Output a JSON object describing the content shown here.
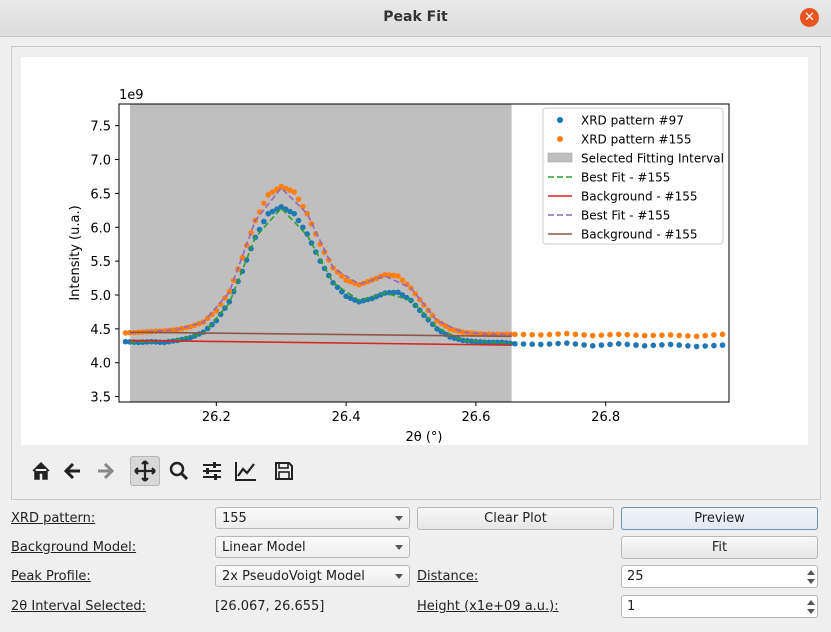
{
  "window": {
    "title": "Peak Fit",
    "close_glyph": "✕"
  },
  "toolbar": {
    "icons": [
      "home-icon",
      "back-arrow-icon",
      "forward-arrow-icon",
      "pan-icon",
      "zoom-icon",
      "configure-subplots-icon",
      "edit-axis-icon",
      "save-icon"
    ],
    "active": "pan-icon"
  },
  "controls": {
    "xrd_pattern_label": "XRD pattern:",
    "xrd_pattern_value": "155",
    "background_model_label": "Background Model:",
    "background_model_value": "Linear Model",
    "peak_profile_label": "Peak Profile:",
    "peak_profile_value": "2x PseudoVoigt Model",
    "interval_label": "2θ Interval Selected:",
    "interval_value": "[26.067, 26.655]",
    "clear_plot": "Clear Plot",
    "preview": "Preview",
    "fit": "Fit",
    "distance_label": "Distance:",
    "distance_value": "25",
    "height_label": "Height (x1e+09 a.u.):",
    "height_value": "1"
  },
  "chart_data": {
    "type": "scatter",
    "xlabel": "2θ (°)",
    "ylabel": "Intensity (u.a.)",
    "y_offset_label": "1e9",
    "xlim": [
      26.05,
      26.99
    ],
    "ylim": [
      3.42,
      7.82
    ],
    "xticks": [
      "26.2",
      "26.4",
      "26.6",
      "26.8"
    ],
    "xtick_values": [
      26.2,
      26.4,
      26.6,
      26.8
    ],
    "yticks": [
      "3.5",
      "4.0",
      "4.5",
      "5.0",
      "5.5",
      "6.0",
      "6.5",
      "7.0",
      "7.5"
    ],
    "ytick_values": [
      3.5,
      4.0,
      4.5,
      5.0,
      5.5,
      6.0,
      6.5,
      7.0,
      7.5
    ],
    "fit_interval": [
      26.067,
      26.655
    ],
    "legend_position": "top-right",
    "legend": [
      "XRD pattern #97",
      "XRD pattern #155",
      "Selected Fitting Interval",
      "Best Fit - #155",
      "Background - #155",
      "Best Fit - #155",
      "Background - #155"
    ],
    "colors": {
      "pattern_97": "#1f77b4",
      "pattern_155": "#ff7f0e",
      "interval": "#bfbfbf",
      "best_fit_1": "#2ca02c",
      "background_1": "#d62728",
      "best_fit_2": "#9467bd",
      "background_2": "#8c564b"
    },
    "series": [
      {
        "name": "XRD pattern #97",
        "x": [
          26.06,
          26.08,
          26.1,
          26.12,
          26.14,
          26.16,
          26.18,
          26.2,
          26.22,
          26.24,
          26.26,
          26.28,
          26.3,
          26.32,
          26.34,
          26.36,
          26.38,
          26.4,
          26.42,
          26.44,
          26.46,
          26.48,
          26.5,
          26.52,
          26.54,
          26.56,
          26.58,
          26.6,
          26.62,
          26.64,
          26.66,
          26.7,
          26.74,
          26.78,
          26.82,
          26.86,
          26.9,
          26.94,
          26.98
        ],
        "y": [
          4.31,
          4.3,
          4.31,
          4.3,
          4.33,
          4.37,
          4.45,
          4.62,
          4.9,
          5.35,
          5.85,
          6.2,
          6.3,
          6.2,
          5.9,
          5.5,
          5.18,
          4.98,
          4.9,
          4.95,
          5.03,
          5.04,
          4.92,
          4.7,
          4.5,
          4.38,
          4.33,
          4.31,
          4.3,
          4.3,
          4.28,
          4.27,
          4.29,
          4.25,
          4.28,
          4.25,
          4.27,
          4.24,
          4.26
        ]
      },
      {
        "name": "XRD pattern #155",
        "x": [
          26.06,
          26.08,
          26.1,
          26.12,
          26.14,
          26.16,
          26.18,
          26.2,
          26.22,
          26.24,
          26.26,
          26.28,
          26.3,
          26.32,
          26.34,
          26.36,
          26.38,
          26.4,
          26.42,
          26.44,
          26.46,
          26.48,
          26.5,
          26.52,
          26.54,
          26.56,
          26.58,
          26.6,
          26.62,
          26.64,
          26.66,
          26.7,
          26.74,
          26.78,
          26.82,
          26.86,
          26.9,
          26.94,
          26.98
        ],
        "y": [
          4.44,
          4.45,
          4.46,
          4.47,
          4.49,
          4.53,
          4.6,
          4.77,
          5.05,
          5.55,
          6.1,
          6.48,
          6.6,
          6.52,
          6.2,
          5.75,
          5.4,
          5.22,
          5.15,
          5.22,
          5.3,
          5.28,
          5.1,
          4.85,
          4.62,
          4.5,
          4.45,
          4.43,
          4.42,
          4.42,
          4.42,
          4.41,
          4.43,
          4.4,
          4.42,
          4.4,
          4.41,
          4.39,
          4.42
        ]
      },
      {
        "name": "Best Fit - #155",
        "x": [
          26.067,
          26.1,
          26.14,
          26.18,
          26.22,
          26.26,
          26.3,
          26.34,
          26.38,
          26.42,
          26.46,
          26.5,
          26.54,
          26.58,
          26.62,
          26.655
        ],
        "y": [
          4.3,
          4.31,
          4.34,
          4.43,
          4.88,
          5.85,
          6.28,
          5.88,
          5.18,
          4.92,
          5.03,
          4.92,
          4.52,
          4.33,
          4.3,
          4.29
        ]
      },
      {
        "name": "Background - #155",
        "x": [
          26.067,
          26.655
        ],
        "y": [
          4.33,
          4.26
        ]
      },
      {
        "name": "Best Fit - #155",
        "x": [
          26.067,
          26.1,
          26.14,
          26.18,
          26.22,
          26.26,
          26.3,
          26.34,
          26.38,
          26.42,
          26.46,
          26.5,
          26.54,
          26.58,
          26.62,
          26.655
        ],
        "y": [
          4.44,
          4.46,
          4.49,
          4.6,
          5.04,
          6.1,
          6.58,
          6.2,
          5.4,
          5.16,
          5.28,
          5.1,
          4.62,
          4.45,
          4.42,
          4.42
        ]
      },
      {
        "name": "Background - #155",
        "x": [
          26.067,
          26.655
        ],
        "y": [
          4.45,
          4.39
        ]
      }
    ]
  }
}
